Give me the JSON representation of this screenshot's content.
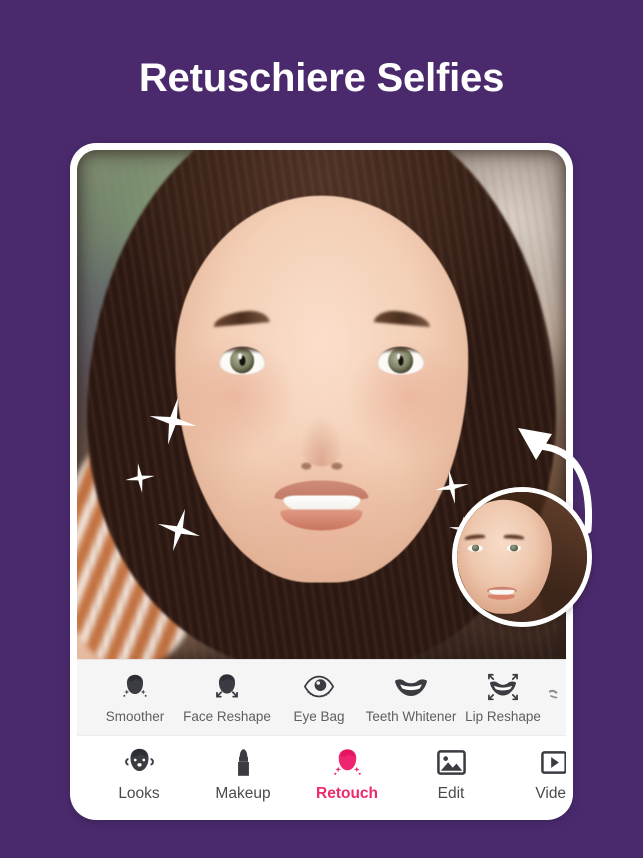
{
  "page": {
    "background_color": "#4a2a6d",
    "accent_color": "#ee2a6e",
    "headline": "Retuschiere Selfies"
  },
  "phone": {
    "photo": {
      "alt_description": "Close-up selfie of smiling young woman with brown hair",
      "sparkle_icons": [
        "sparkle-icon",
        "sparkle-icon",
        "sparkle-icon",
        "sparkle-icon",
        "sparkle-icon"
      ],
      "before_preview": {
        "alt_description": "Circular before photo thumbnail of the same woman",
        "arrow_icon": "curved-arrow-icon"
      }
    },
    "tool_strip": {
      "tools": [
        {
          "label": "Smoother",
          "icon": "face-sparkle-icon"
        },
        {
          "label": "Face Reshape",
          "icon": "face-reshape-icon"
        },
        {
          "label": "Eye Bag",
          "icon": "eye-icon"
        },
        {
          "label": "Teeth Whitener",
          "icon": "teeth-icon"
        },
        {
          "label": "Lip Reshape",
          "icon": "lip-reshape-icon"
        }
      ],
      "partial_next_tool": "cut-off-tool-icon"
    },
    "bottom_nav": {
      "items": [
        {
          "label": "Looks",
          "icon": "looks-face-icon",
          "active": false
        },
        {
          "label": "Makeup",
          "icon": "lipstick-icon",
          "active": false
        },
        {
          "label": "Retouch",
          "icon": "retouch-face-icon",
          "active": true
        },
        {
          "label": "Edit",
          "icon": "image-icon",
          "active": false
        },
        {
          "label": "Video",
          "icon": "video-play-icon",
          "active": false
        }
      ]
    }
  }
}
